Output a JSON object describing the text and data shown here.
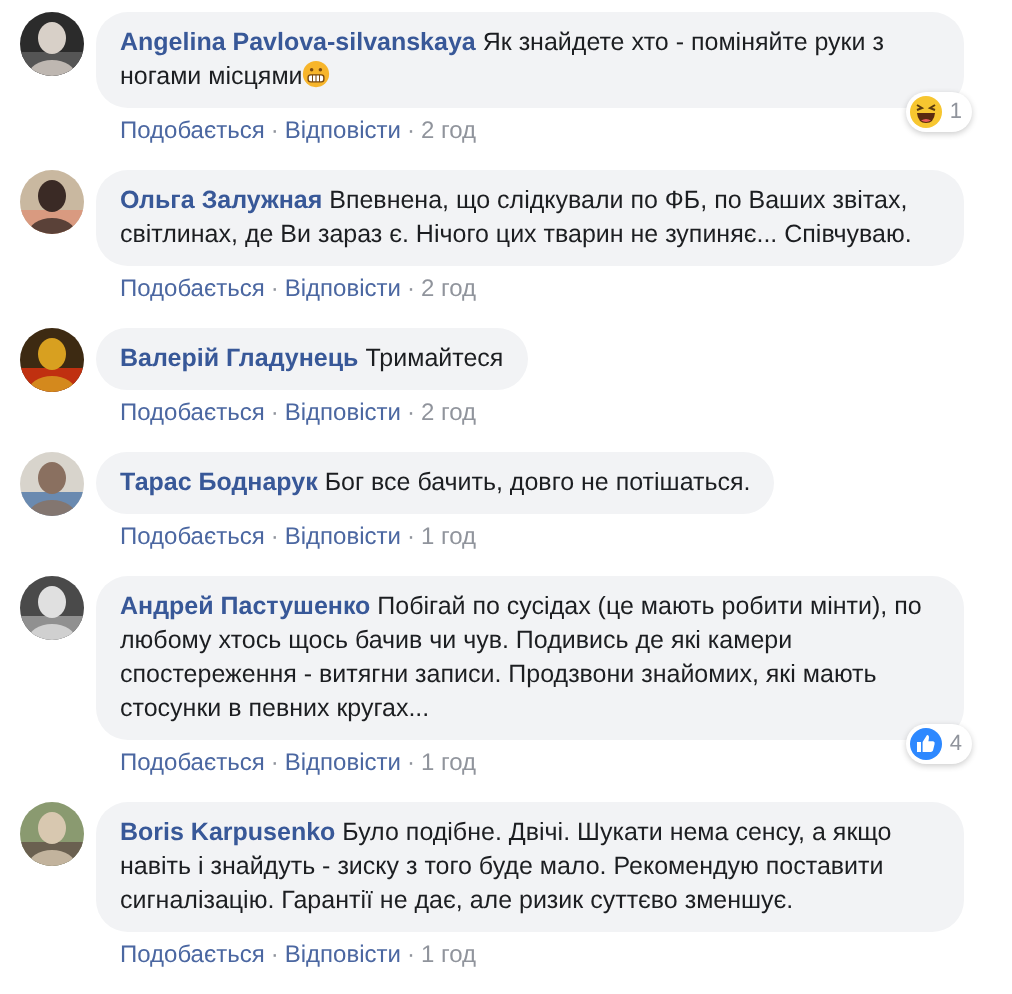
{
  "comments": [
    {
      "author": "Angelina Pavlova-silvanskaya",
      "text": "Як знайдете хто - поміняйте руки з ногами місцями",
      "emoji": true,
      "reaction": {
        "kind": "haha",
        "count": "1"
      },
      "separator": "·",
      "like": "Подобається",
      "reply": "Відповісти",
      "time": "2 год"
    },
    {
      "author": "Ольга Залужная",
      "text": "Впевнена, що слідкували по ФБ, по Ваших звітах, світлинах, де Ви зараз є. Нічого цих тварин не зупиняє... Співчуваю.",
      "emoji": false,
      "separator": "·",
      "like": "Подобається",
      "reply": "Відповісти",
      "time": "2 год"
    },
    {
      "author": "Валерій Гладунець",
      "text": "Тримайтеся",
      "emoji": false,
      "separator": "·",
      "like": "Подобається",
      "reply": "Відповісти",
      "time": "2 год"
    },
    {
      "author": "Тарас Боднарук",
      "text": "Бог все бачить, довго не потішаться.",
      "emoji": false,
      "separator": "·",
      "like": "Подобається",
      "reply": "Відповісти",
      "time": "1 год"
    },
    {
      "author": "Андрей Пастушенко",
      "text": "Побігай по сусідах (це мають робити мінти), по любому хтось щось бачив чи чув. Подивись де які камери спостереження - витягни записи. Продзвони знайомих, які мають стосунки в певних кругах...",
      "emoji": false,
      "reaction": {
        "kind": "like",
        "count": "4"
      },
      "separator": "·",
      "like": "Подобається",
      "reply": "Відповісти",
      "time": "1 год"
    },
    {
      "author": "Boris Karpusenko",
      "text": "Було подібне. Двічі. Шукати нема сенсу, а якщо навіть і знайдуть - зиску з того буде мало. Рекомендую поставити сигналізацію. Гарантії не дає, але ризик суттєво зменшує.",
      "emoji": false,
      "separator": "·",
      "like": "Подобається",
      "reply": "Відповісти",
      "time": "1 год"
    }
  ]
}
